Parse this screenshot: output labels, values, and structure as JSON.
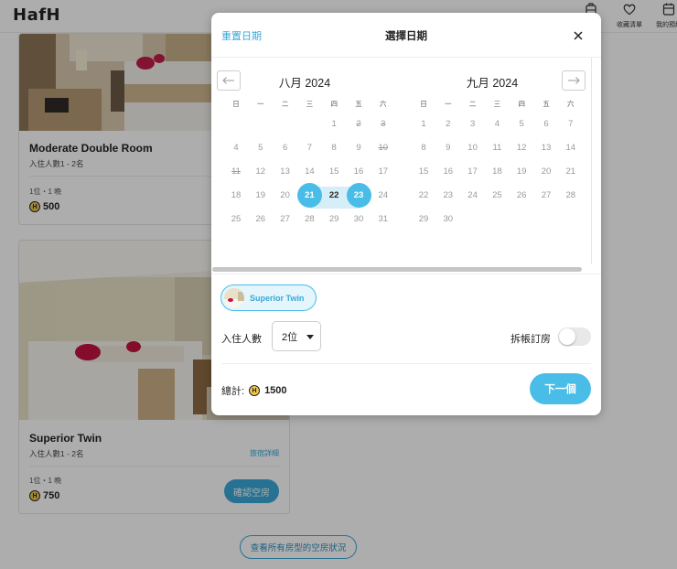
{
  "app": {
    "logo": "HafH",
    "nav": [
      {
        "label": "",
        "icon": "luggage-icon"
      },
      {
        "label": "收藏清單",
        "icon": "heart-icon"
      },
      {
        "label": "我的預約",
        "icon": "calendar-icon"
      }
    ]
  },
  "rooms": [
    {
      "name": "Moderate Double Room",
      "capacity": "入住人數1 - 2名",
      "unit": "1位・1 晚",
      "price": "500"
    },
    {
      "name": "Superior Twin",
      "capacity": "入住人數1 - 2名",
      "unit": "1位・1 晚",
      "price": "750",
      "detail_link": "旅宿詳細",
      "check_button": "確認空房"
    }
  ],
  "all_rooms_button": "查看所有房型的空房狀況",
  "modal": {
    "reset_label": "重置日期",
    "title": "選擇日期",
    "close_icon": "close-icon",
    "prev_icon": "arrow-left-icon",
    "next_icon": "arrow-right-icon",
    "weekdays": [
      "日",
      "一",
      "二",
      "三",
      "四",
      "五",
      "六"
    ],
    "months": [
      {
        "title": "八月 2024",
        "weeks": [
          [
            "",
            "",
            "",
            "",
            "1",
            "2",
            "3"
          ],
          [
            "4",
            "5",
            "6",
            "7",
            "8",
            "9",
            "10"
          ],
          [
            "11",
            "12",
            "13",
            "14",
            "15",
            "16",
            "17"
          ],
          [
            "18",
            "19",
            "20",
            "21",
            "22",
            "23",
            "24"
          ],
          [
            "25",
            "26",
            "27",
            "28",
            "29",
            "30",
            "31"
          ]
        ],
        "struck": [
          "2",
          "3",
          "10",
          "11"
        ],
        "range_start": "21",
        "range_mid": [
          "22"
        ],
        "range_end": "23"
      },
      {
        "title": "九月 2024",
        "weeks": [
          [
            "1",
            "2",
            "3",
            "4",
            "5",
            "6",
            "7"
          ],
          [
            "8",
            "9",
            "10",
            "11",
            "12",
            "13",
            "14"
          ],
          [
            "15",
            "16",
            "17",
            "18",
            "19",
            "20",
            "21"
          ],
          [
            "22",
            "23",
            "24",
            "25",
            "26",
            "27",
            "28"
          ],
          [
            "29",
            "30",
            "",
            "",
            "",
            "",
            ""
          ]
        ]
      }
    ],
    "room_chip": "Superior Twin",
    "guests_label": "入住人數",
    "guests_value": "2位",
    "split_label": "拆帳訂房",
    "split_on": false,
    "total_label": "總計:",
    "total_value": "1500",
    "coin_symbol": "H",
    "next_button": "下一個",
    "accent_color": "#49bde8"
  }
}
